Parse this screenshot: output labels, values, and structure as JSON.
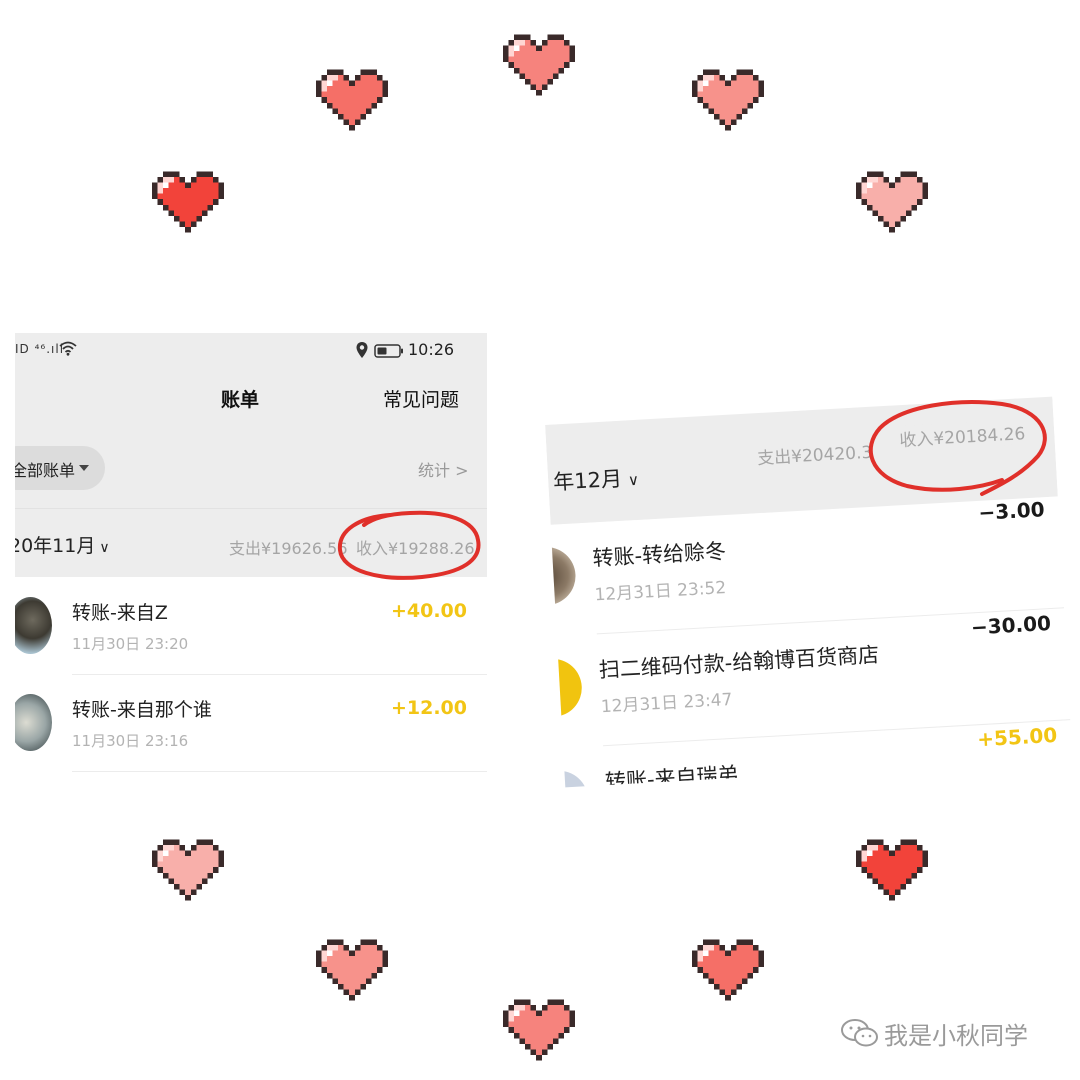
{
  "left_screenshot": {
    "status_bar": {
      "signal_text": "ID ⁴⁶.ıll",
      "time": "10:26"
    },
    "nav": {
      "title": "账单",
      "faq": "常见问题"
    },
    "filter": {
      "label": "全部账单"
    },
    "stats_link": "统计 >",
    "month": {
      "label": "20年11月",
      "expense": "支出¥19626.56",
      "income": "收入¥19288.26"
    },
    "transactions": [
      {
        "title": "转账-来自Z",
        "date": "11月30日 23:20",
        "amount": "+40.00"
      },
      {
        "title": "转账-来自那个谁",
        "date": "11月30日 23:16",
        "amount": "+12.00"
      }
    ]
  },
  "right_screenshot": {
    "month": {
      "label": "年12月",
      "expense": "支出¥20420.3",
      "income": "收入¥20184.26"
    },
    "transactions": [
      {
        "title": "转账-转给赊冬",
        "date": "12月31日 23:52",
        "amount": "−3.00"
      },
      {
        "title": "扫二维码付款-给翰博百货商店",
        "date": "12月31日 23:47",
        "amount": "−30.00"
      },
      {
        "title": "转账-来自瑞弟",
        "date": "",
        "amount": "+55.00"
      }
    ]
  },
  "watermark": {
    "text": "我是小秋同学"
  },
  "colors": {
    "income_yellow": "#f2c515",
    "expense_black": "#1a1a1a",
    "annotation_red": "#e0302a",
    "header_grey": "#ededed"
  },
  "icons": [
    "heart-icon",
    "wifi-icon",
    "location-icon",
    "battery-icon",
    "caret-down-icon",
    "chevron-down-icon",
    "wechat-icon"
  ]
}
